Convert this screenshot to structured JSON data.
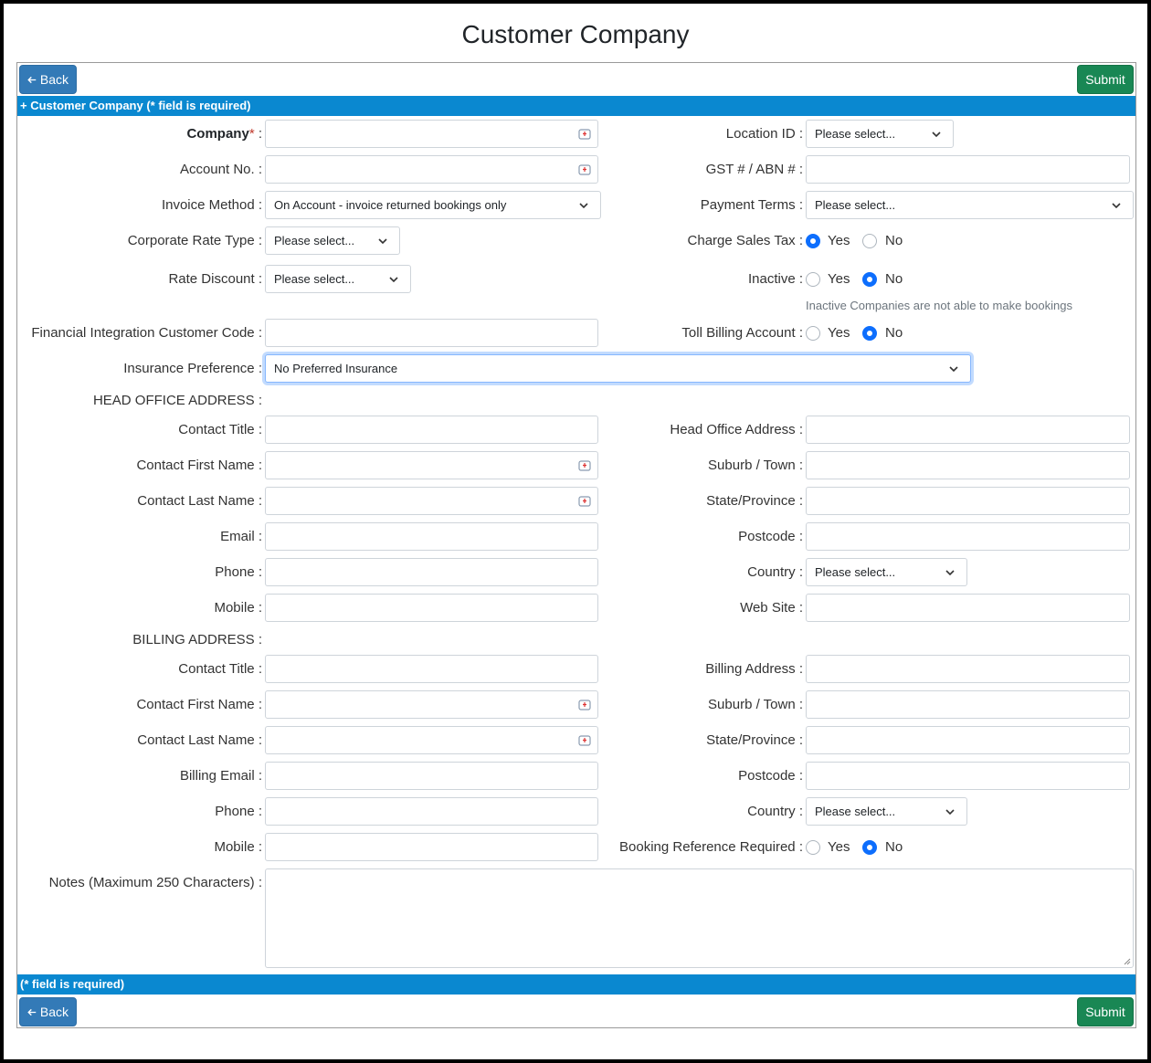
{
  "page": {
    "title": "Customer Company"
  },
  "toolbar": {
    "back_label": "Back",
    "submit_label": "Submit"
  },
  "section": {
    "header": "+ Customer Company (* field is required)",
    "footer": "(* field is required)"
  },
  "labels": {
    "company": "Company",
    "account_no": "Account No. :",
    "invoice_method": "Invoice Method :",
    "corporate_rate_type": "Corporate Rate Type :",
    "rate_discount": "Rate Discount :",
    "financial_code": "Financial Integration Customer Code :",
    "insurance_pref": "Insurance Preference :",
    "location_id": "Location ID :",
    "gst_abn": "GST # / ABN # :",
    "payment_terms": "Payment Terms :",
    "charge_sales_tax": "Charge Sales Tax :",
    "inactive": "Inactive :",
    "inactive_hint": "Inactive Companies are not able to make bookings",
    "toll_billing": "Toll Billing Account :",
    "head_office_address_section": "HEAD OFFICE ADDRESS :",
    "billing_address_section": "BILLING ADDRESS :",
    "contact_title": "Contact Title :",
    "contact_first_name": "Contact First Name :",
    "contact_last_name": "Contact Last Name :",
    "email": "Email :",
    "billing_email": "Billing Email :",
    "phone": "Phone :",
    "mobile": "Mobile :",
    "head_office_address": "Head Office Address :",
    "billing_address": "Billing Address :",
    "suburb_town": "Suburb / Town :",
    "state_province": "State/Province :",
    "postcode": "Postcode :",
    "country": "Country :",
    "web_site": "Web Site :",
    "booking_ref": "Booking Reference Required :",
    "notes": "Notes (Maximum 250 Characters) :",
    "yes": "Yes",
    "no": "No"
  },
  "selects": {
    "location_id": "Please select...",
    "invoice_method": "On Account - invoice returned bookings only",
    "payment_terms": "Please select...",
    "corporate_rate_type": "Please select...",
    "rate_discount": "Please select...",
    "insurance_pref": "No Preferred Insurance",
    "head_country": "Please select...",
    "billing_country": "Please select..."
  },
  "radios": {
    "charge_sales_tax": "Yes",
    "inactive": "No",
    "toll_billing": "No",
    "booking_ref": "No"
  },
  "colors": {
    "back_button": "#337ab7",
    "submit_button": "#198754",
    "section_bar": "#0a88d0",
    "radio_selected": "#0d6efd"
  }
}
